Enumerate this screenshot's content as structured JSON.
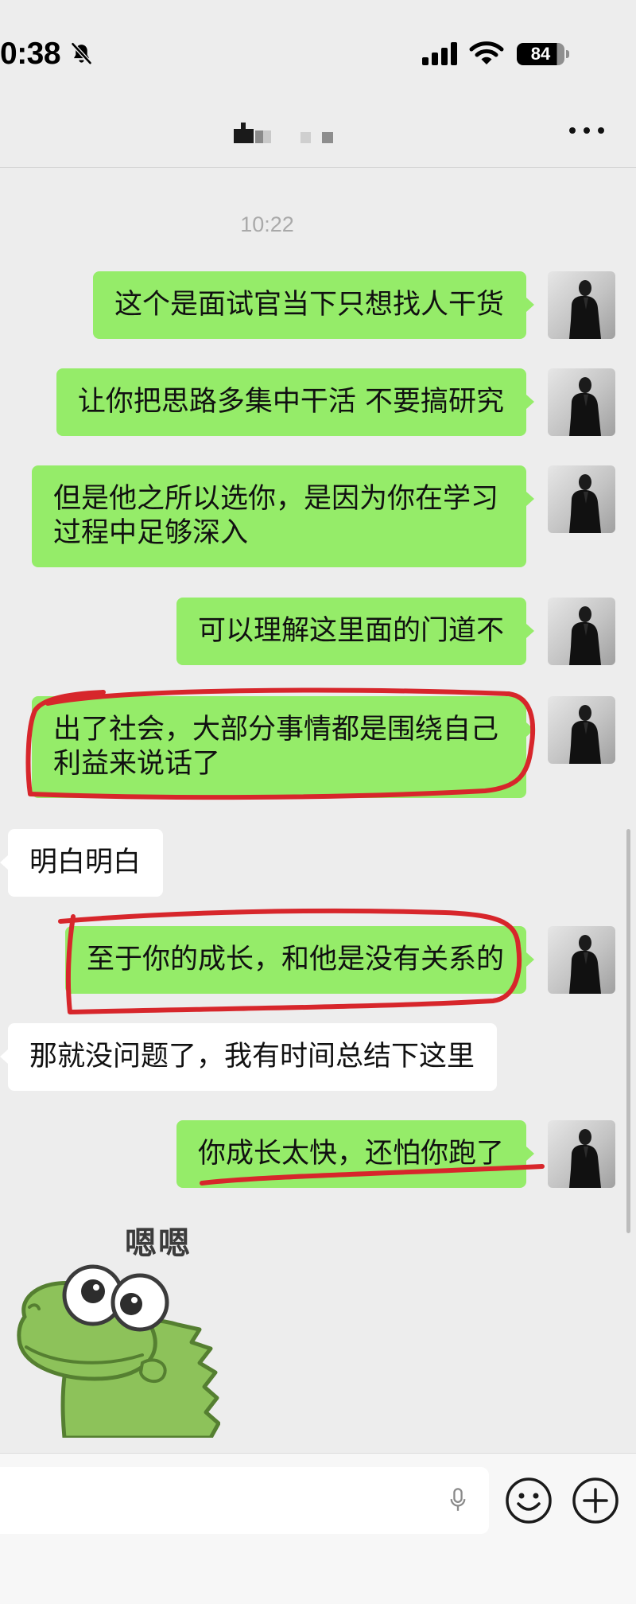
{
  "status_bar": {
    "time": "0:38",
    "battery": "84",
    "icons": [
      "bell-off-icon",
      "signal-icon",
      "wifi-icon",
      "battery-icon"
    ]
  },
  "header": {
    "more_icon": "more-icon"
  },
  "chat": {
    "timestamp": "10:22",
    "avatar_icon": "avatar-icon",
    "messages": [
      {
        "outgoing": true,
        "text": "这个是面试官当下只想找人干货"
      },
      {
        "outgoing": true,
        "text": "让你把思路多集中干活 不要搞研究"
      },
      {
        "outgoing": true,
        "text": "但是他之所以选你，是因为你在学习过程中足够深入"
      },
      {
        "outgoing": true,
        "text": "可以理解这里面的门道不"
      },
      {
        "outgoing": true,
        "text": "出了社会，大部分事情都是围绕自己利益来说话了"
      },
      {
        "outgoing": false,
        "text": "明白明白"
      },
      {
        "outgoing": true,
        "text": "至于你的成长，和他是没有关系的"
      },
      {
        "outgoing": false,
        "text": "那就没问题了，我有时间总结下这里"
      },
      {
        "outgoing": true,
        "text": "你成长太快，还怕你跑了"
      }
    ],
    "sticker": {
      "outgoing": false,
      "caption": "嗯嗯"
    }
  },
  "input_bar": {
    "value": "",
    "icons": [
      "mic-icon",
      "emoji-icon",
      "plus-icon"
    ]
  },
  "colors": {
    "background": "#ededed",
    "outgoing_bubble": "#95ec69",
    "incoming_bubble": "#ffffff",
    "annotation_red": "#d7262b",
    "input_bar": "#f7f7f7"
  }
}
